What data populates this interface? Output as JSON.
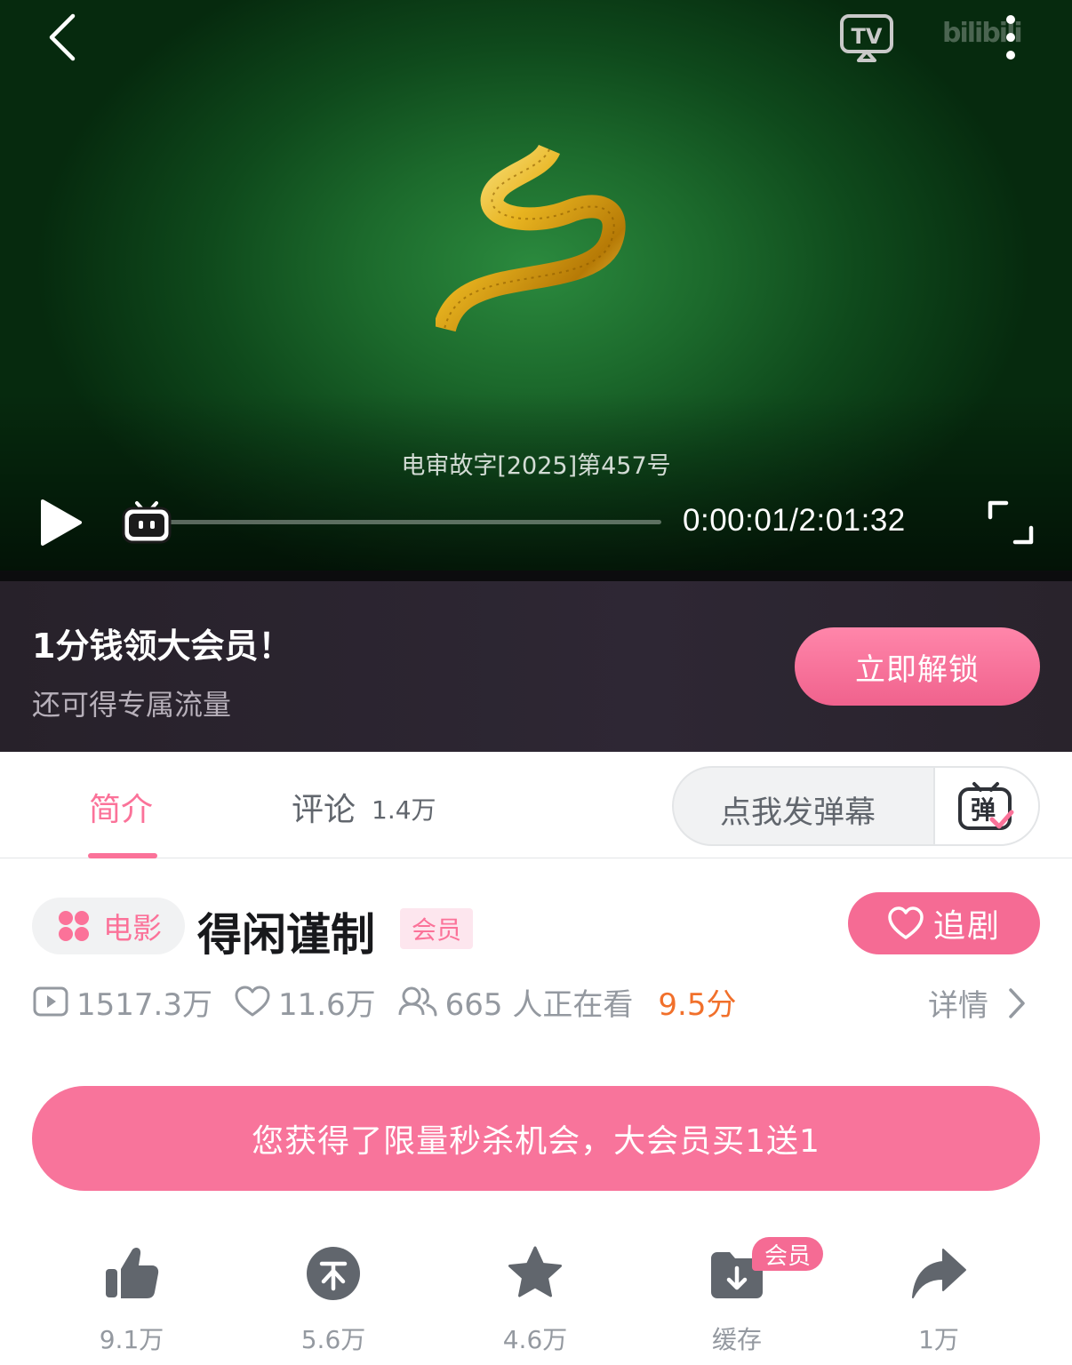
{
  "player": {
    "cert_text": "电审故字[2025]第457号",
    "time": "0:00:01/2:01:32",
    "progress": 0.0001,
    "watermark": "bilibili"
  },
  "vip_banner": {
    "title": "1分钱领大会员！",
    "subtitle": "还可得专属流量",
    "button": "立即解锁"
  },
  "tabs": {
    "intro": "简介",
    "comments": "评论",
    "comments_count": "1.4万",
    "danmaku_placeholder": "点我发弹幕"
  },
  "video": {
    "category": "电影",
    "title": "得闲谨制",
    "member_tag": "会员",
    "follow_label": "追剧",
    "plays": "1517.3万",
    "likes": "11.6万",
    "watching": "665 人正在看",
    "score": "9.5分",
    "detail": "详情"
  },
  "promo": {
    "text": "您获得了限量秒杀机会，大会员买1送1"
  },
  "actions": {
    "like": "9.1万",
    "coin": "5.6万",
    "favorite": "4.6万",
    "download": "缓存",
    "download_badge": "会员",
    "share": "1万"
  },
  "colors": {
    "accent": "#fb7299",
    "score": "#f1702b",
    "player_bg": "#1c6a2c",
    "banner_bg": "#2e2734"
  }
}
